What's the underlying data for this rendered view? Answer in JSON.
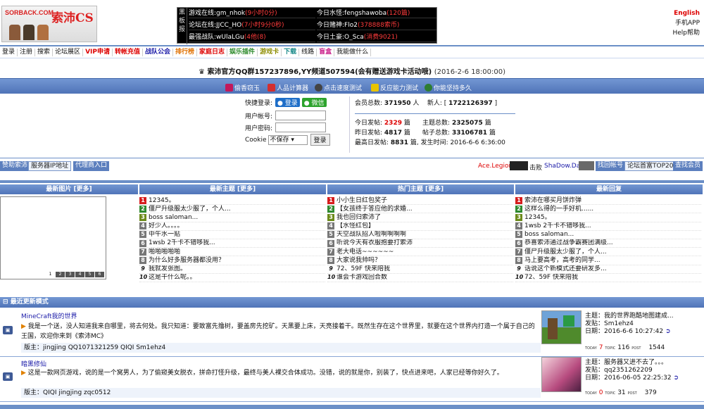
{
  "logo": {
    "en": "SORBACK.COM",
    "cn": "索沛CS"
  },
  "board": {
    "side_label": "黑板报",
    "cells": [
      {
        "text": "游戏在线:gm_nhok",
        "red": "(9小时0分)"
      },
      {
        "text": "今日水怪:fengshawoba",
        "red": "(120篇)"
      },
      {
        "text": "论坛在线:JJCC_HO",
        "red": "(7小时9分0秒)"
      },
      {
        "text": "今日赌神:Flo2",
        "red": "(378888索币)"
      },
      {
        "text": "最强战队:wUlaLGu",
        "red": "(4他(8)"
      },
      {
        "text": "今日土豪:O_Sca",
        "red": "(消费9021)"
      }
    ]
  },
  "top_right": {
    "english": "English",
    "app": "手机APP",
    "help": "Help帮助"
  },
  "nav": [
    {
      "label": "登录",
      "color": "#111"
    },
    {
      "label": "注册",
      "color": "#111"
    },
    {
      "label": "搜索",
      "color": "#111"
    },
    {
      "label": "论坛展区",
      "color": "#111"
    },
    {
      "label": "VIP申请",
      "color": "#d00"
    },
    {
      "label": "转帐充值",
      "color": "#d00"
    },
    {
      "label": "战队公会",
      "color": "#1a1aa8"
    },
    {
      "label": "排行榜",
      "color": "#e07000"
    },
    {
      "label": "家庭日志",
      "color": "#d00"
    },
    {
      "label": "娱乐插件",
      "color": "#2c8a2c"
    },
    {
      "label": "游戏卡",
      "color": "#8c8c00"
    },
    {
      "label": "下载",
      "color": "#1a8a8a"
    },
    {
      "label": "线路",
      "color": "#111"
    },
    {
      "label": "盲盒",
      "color": "#c71585"
    },
    {
      "label": "我能做什么",
      "color": "#111"
    }
  ],
  "notice": {
    "text": "索沛官方QQ群157237896,YY频道507594(会有赠送游戏卡活动哦)",
    "date": "(2016-2-6 18:00:00)"
  },
  "band_links": [
    "偷香窃玉",
    "人品计算器",
    "点击速度测试",
    "反应能力测试",
    "你能坚持多久"
  ],
  "login": {
    "quick_label": "快捷登录:",
    "qq_btn": "登录",
    "wechat_btn": "微信",
    "user_label": "用户帐号:",
    "pass_label": "用户密码:",
    "cookie_label": "Cookie",
    "cookie_value": "不保存",
    "submit": "登录"
  },
  "stats": {
    "members_label": "会员总数:",
    "members": "371950",
    "members_unit": "人",
    "newbie_label": "新人:",
    "newbie": "1722126397",
    "today_label": "今日发帖:",
    "today": "2329",
    "today_unit": "篇",
    "topics_label": "主题总数:",
    "topics": "2325075",
    "topics_unit": "篇",
    "yday_label": "昨日发帖:",
    "yday": "4817",
    "yday_unit": "篇",
    "posts_label": "帖子总数:",
    "posts": "33106781",
    "posts_unit": "篇",
    "peak_label": "最高日发帖:",
    "peak": "8831",
    "peak_unit": "篇, 发生时间:",
    "peak_time": "2016-6-6 6:36:00"
  },
  "link_row": {
    "left": [
      "赞助索沛",
      "服务器IP地址",
      "代理商入口"
    ],
    "kill_left": "Ace.Legion",
    "kill_mid": "击败",
    "kill_right": "ShaDow.Dark",
    "right": [
      "找回帐号",
      "论坛首富TOP20",
      "查找会员"
    ]
  },
  "columns": {
    "pics": "最新图片 [更多]",
    "topics": "最新主题 [更多]",
    "hot": "热门主题 [更多]",
    "replies": "最新回复"
  },
  "pager": [
    "1",
    "2",
    "3",
    "4",
    "5",
    "6"
  ],
  "topics": [
    "12345。",
    "僵尸升级服太少服了，个人...",
    "boss saloman...",
    "好少人。。。。",
    "中午水一贴",
    "1wsb 2千卡不错哆我...",
    "啪啪啪啪啪",
    "为什么好多服务器都没用？",
    "我就发张图。",
    "这是干什么呢。。"
  ],
  "hot": [
    "小小生日红包奖子",
    "【女孩终于答应他的求婚...",
    "我也回归索沛了",
    "【水怪红包】",
    "天空战队招人啦啊啊啊啊",
    "听说今天有衣服抱要打索沛",
    "老大电话~~~~~~",
    "大家说我帅吗？",
    "72、59F 快来陪我",
    "谁会卡游戏回合数"
  ],
  "replies": [
    "索沛在哪买月饼炸弹",
    "这样么得的一手好机......",
    "12345。",
    "1wsb 2千卡不错哆我...",
    "boss saloman...",
    "恭喜索沛通过战争霸赛团满级...",
    "僵尸升级服太少服了，个人...",
    "马上要高考，高考的同学...",
    "话说这个新模式还要研发多...",
    "72、59F 快来陪我"
  ],
  "mode_head": "最近更新模式",
  "forums": [
    {
      "title": "MineCraft我的世界",
      "desc": "我是一个送，没人知道我来自哪里，将去何处。我只知道：要致富先撸树，要盖房先挖矿。天黑要上床，天亮接着干。既然生存在这个世界里，就要在这个世界内打造一个属于自己的王国，欢迎你来到《索沛MC》",
      "mods": "版主：jingjing QQ1071321259 QIQI Sm1ehz4",
      "last_topic": "主题：我的世界跑酷地图建成...",
      "last_author": "发贴：Sm1ehz4",
      "last_date": "日期：2016-6-6 10:27:42",
      "today_n": "7",
      "topic_n": "116",
      "post_n": "1544",
      "today_label": "TODAY",
      "topic_label": "TOPIC",
      "post_label": "POST"
    },
    {
      "title": "暗黑修仙",
      "desc": "这是一款网页游戏，说的是一个窝男人，为了偷窥美女脱衣，拼命打怪升级，最终与美人裸交合体成功。没错，说的就是你，别装了，快点进来吧，人家已经等你好久了。",
      "mods": "版主：QIQI jingjing zqc0512",
      "last_topic": "主题：服务器又进不去了。。。",
      "last_author": "发贴：qq2351262209",
      "last_date": "日期：2016-06-05 22:25:32",
      "today_n": "0",
      "topic_n": "31",
      "post_n": "379",
      "today_label": "TODAY",
      "topic_label": "TOPIC",
      "post_label": "POST"
    }
  ]
}
